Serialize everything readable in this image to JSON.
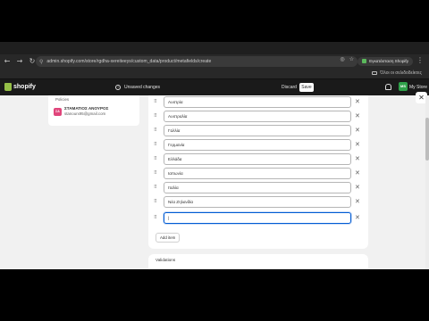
{
  "browser": {
    "url": "admin.shopify.com/store/rgdha-xereiteeys/custom_data/product/metafields/create",
    "install_label": "Εγκατάσταση Shopify",
    "bookmarks_label": "Όλοι οι σελιδοδείκτες"
  },
  "topbar": {
    "logo_text": "shopify",
    "unsaved_text": "Unsaved changes",
    "discard_label": "Discard",
    "save_label": "Save",
    "store_initials": "MS",
    "store_name": "My Store"
  },
  "sidebar_card": {
    "previous_item": "Policies",
    "user_initials": "ΣΑ",
    "user_name": "ΣΤΑΜΑΤΙΟΣ ΑΝΟΥΡΟΣ",
    "user_email": "stanourx95@gmail.com"
  },
  "choices": {
    "items": [
      {
        "value": "Αυστρία"
      },
      {
        "value": "Αυστραλία"
      },
      {
        "value": "Γαλλία"
      },
      {
        "value": "Γερμανία"
      },
      {
        "value": "Ελλάδα"
      },
      {
        "value": "Ιαπωνία"
      },
      {
        "value": "Ιταλία"
      },
      {
        "value": "Νέα Ζηλανδία"
      },
      {
        "value": "|"
      }
    ],
    "add_item_label": "Add item"
  },
  "next_section_title": "Validations",
  "icons": {
    "drag": "drag-handle-icon",
    "remove": "close-icon",
    "back": "arrow-left-icon",
    "forward": "arrow-right-icon",
    "reload": "reload-icon",
    "bell": "bell-icon"
  },
  "colors": {
    "topbar_bg": "#1a1a1a",
    "focus_blue": "#005bd3",
    "shopify_green": "#95bf47",
    "store_avatar": "#2fa14a",
    "user_avatar": "#e0457b"
  }
}
